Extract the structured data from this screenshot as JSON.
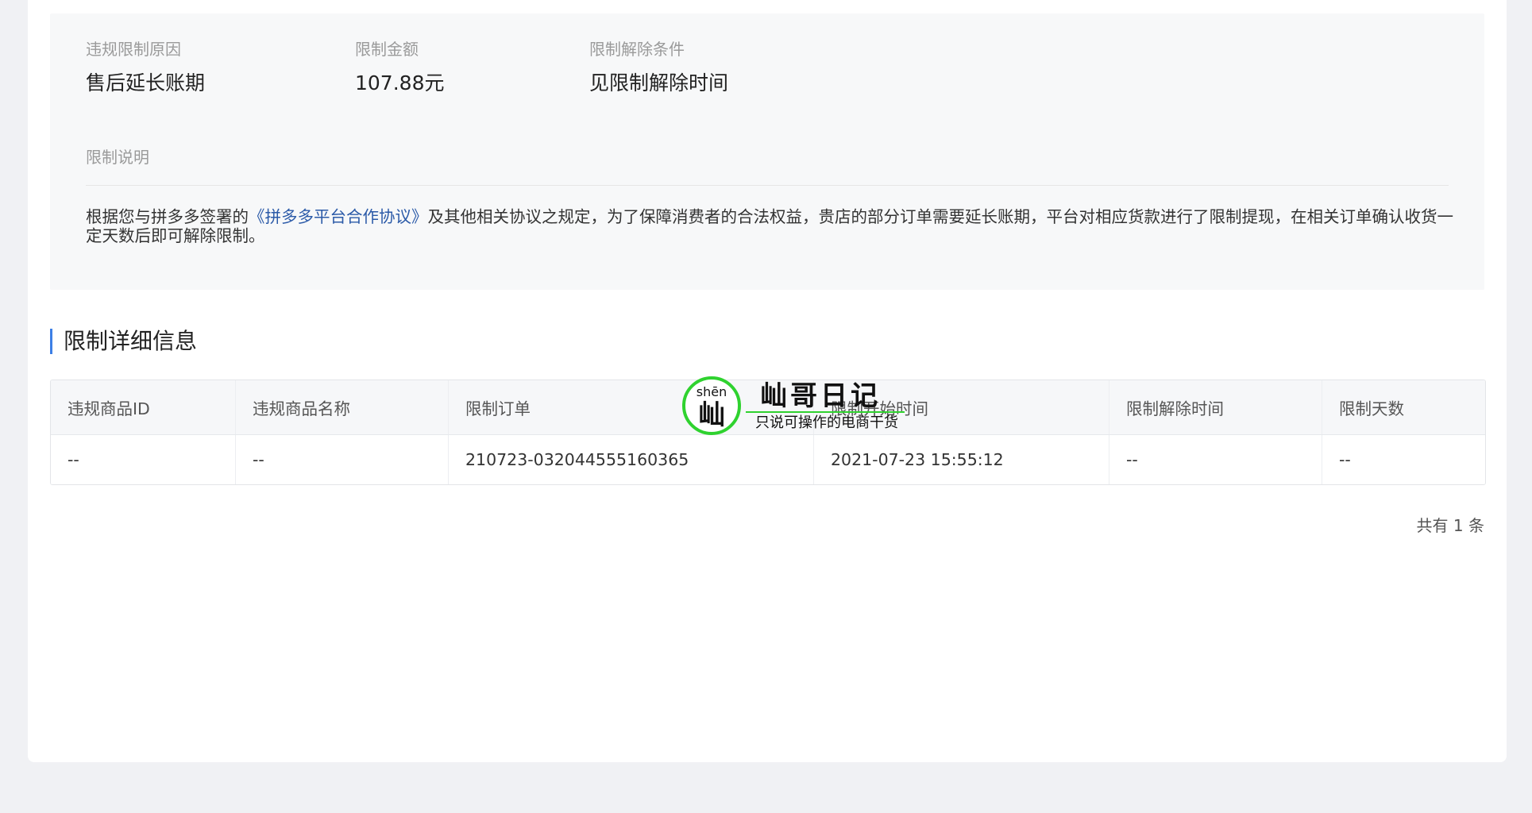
{
  "summary": {
    "reason_label": "违规限制原因",
    "reason_value": "售后延长账期",
    "amount_label": "限制金额",
    "amount_value": "107.88元",
    "release_label": "限制解除条件",
    "release_value": "见限制解除时间",
    "desc_title": "限制说明",
    "desc_before": "根据您与拼多多签署的",
    "desc_link": "《拼多多平台合作协议》",
    "desc_after": "及其他相关协议之规定，为了保障消费者的合法权益，贵店的部分订单需要延长账期，平台对相应货款进行了限制提现，在相关订单确认收货一定天数后即可解除限制。"
  },
  "section_title": "限制详细信息",
  "table": {
    "headers": [
      "违规商品ID",
      "违规商品名称",
      "限制订单",
      "限制开始时间",
      "限制解除时间",
      "限制天数"
    ],
    "rows": [
      [
        "--",
        "--",
        "210723-032044555160365",
        "2021-07-23 15:55:12",
        "--",
        "--"
      ]
    ]
  },
  "pagination": {
    "total_text": "共有 1 条"
  },
  "watermark": {
    "pinyin": "shēn",
    "char": "屾",
    "brand": "屾哥日记",
    "slogan": "只说可操作的电商干货",
    "accent_color": "#2fd22f"
  }
}
